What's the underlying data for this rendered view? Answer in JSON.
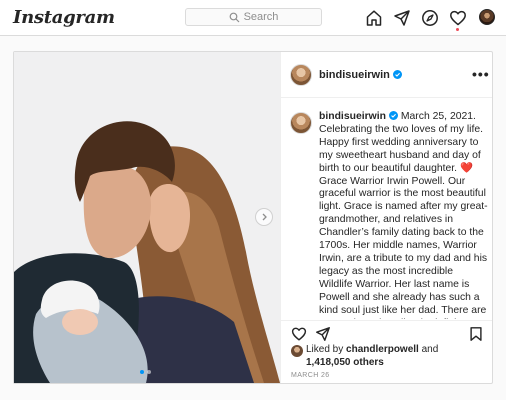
{
  "app": {
    "logo": "Instagram",
    "search_placeholder": "Search",
    "icons": [
      "home-icon",
      "direct-icon",
      "explore-icon",
      "activity-heart-icon",
      "profile-avatar"
    ],
    "brand_colors": {
      "accent": "#0095f6",
      "like_red": "#ed4956",
      "text": "#262626",
      "muted": "#8e8e8e",
      "border": "#dbdbdb"
    }
  },
  "post": {
    "username": "bindisueirwin",
    "more_label": "•••",
    "caption_date": "March 25, 2021.",
    "caption_part1": "Celebrating the two loves of my life. Happy first wedding anniversary to my sweetheart husband and day of birth to our beautiful daughter.",
    "caption_emoji": "❤️",
    "caption_part2": "Grace Warrior Irwin Powell. Our graceful warrior is the most beautiful light. Grace is named after my great-grandmother, and relatives in Chandler’s family dating back to the 1700s. Her middle names, Warrior Irwin, are a tribute to my dad and his legacy as the most incredible Wildlife Warrior. Her last name is Powell and she already has such a kind soul just like her dad. There are no words to describe the infinite amount of love in our hearts for our sweet baby girl. She chose the perfect day to be born to the love we share.",
    "liked_by_prefix": "Liked by",
    "liked_by_user": "chandlerpowell",
    "liked_by_and": "and",
    "others_count": "1,418,050 others",
    "timestamp": "MARCH 26",
    "carousel": {
      "slides": 2,
      "current": 1
    }
  }
}
